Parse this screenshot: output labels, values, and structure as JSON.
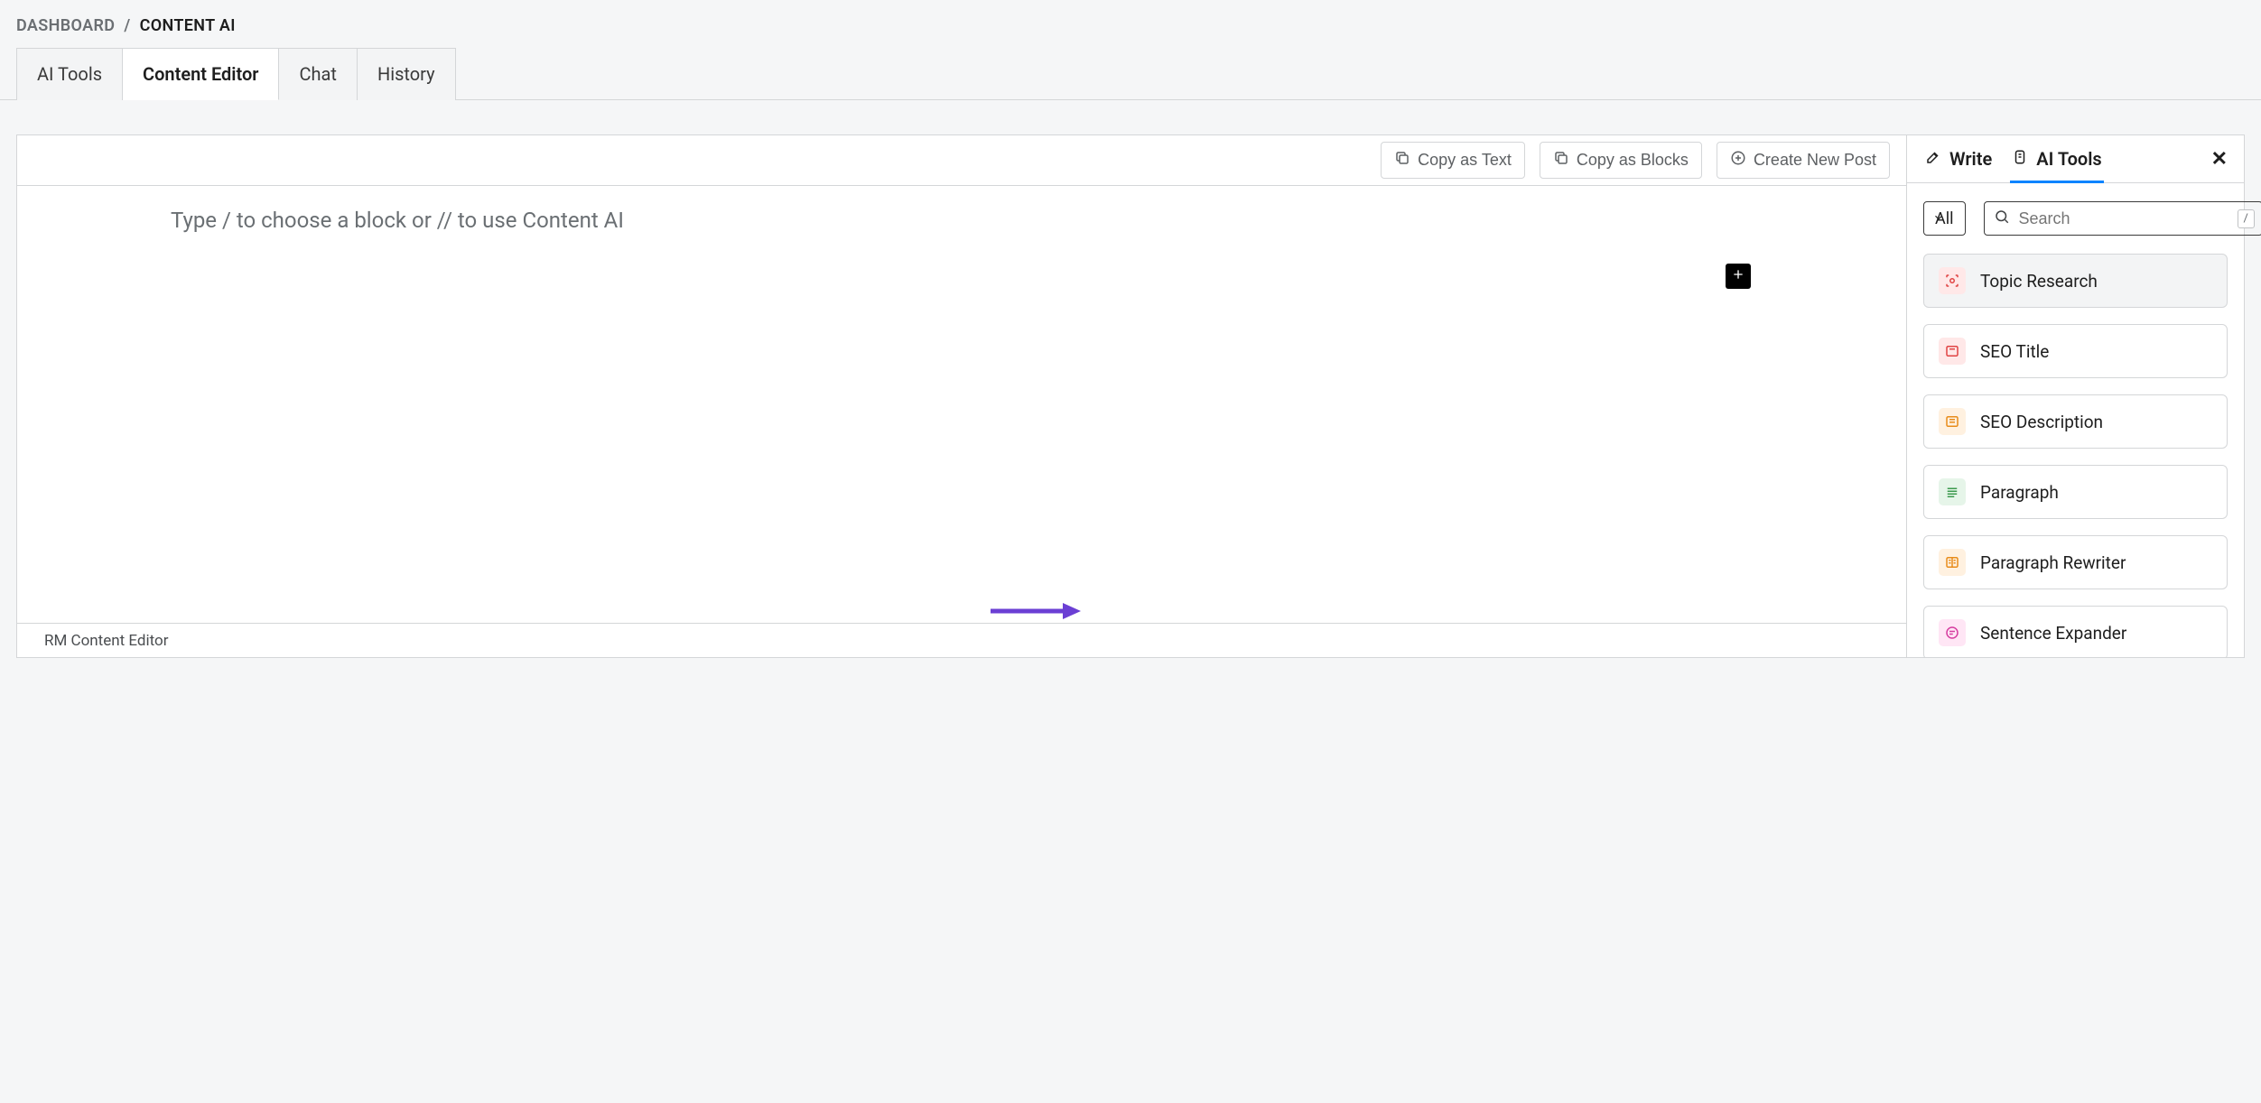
{
  "breadcrumb": {
    "root": "DASHBOARD",
    "sep": "/",
    "current": "CONTENT AI"
  },
  "tabs": {
    "ai_tools": "AI Tools",
    "content_editor": "Content Editor",
    "chat": "Chat",
    "history": "History"
  },
  "toolbar": {
    "copy_text": "Copy as Text",
    "copy_blocks": "Copy as Blocks",
    "new_post": "Create New Post"
  },
  "editor": {
    "placeholder": "Type / to choose a block or // to use Content AI"
  },
  "footer": {
    "label": "RM Content Editor"
  },
  "side": {
    "tab_write": "Write",
    "tab_ai": "AI Tools",
    "filter_value": "All",
    "search_placeholder": "Search",
    "search_kbd": "/",
    "tools": [
      {
        "label": "Topic Research",
        "icon": "scan",
        "tint": "red"
      },
      {
        "label": "SEO Title",
        "icon": "title",
        "tint": "red"
      },
      {
        "label": "SEO Description",
        "icon": "desc",
        "tint": "orange"
      },
      {
        "label": "Paragraph",
        "icon": "para",
        "tint": "green"
      },
      {
        "label": "Paragraph Rewriter",
        "icon": "book",
        "tint": "orange"
      },
      {
        "label": "Sentence Expander",
        "icon": "expand",
        "tint": "pink"
      }
    ]
  }
}
